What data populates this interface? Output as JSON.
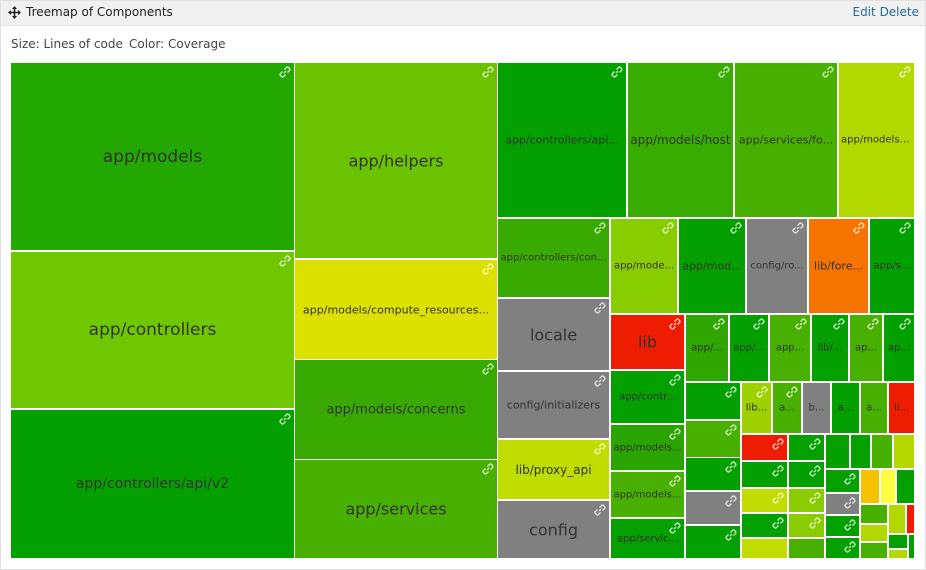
{
  "header": {
    "title": "Treemap of Components",
    "edit_label": "Edit",
    "delete_label": "Delete"
  },
  "subtitle": {
    "size": "Size: Lines of code",
    "color": "Color: Coverage"
  },
  "chart_data": {
    "type": "treemap",
    "size_metric": "Lines of code",
    "color_metric": "Coverage",
    "legend": "none",
    "tiles": [
      {
        "label": "app/models",
        "color": "#22a800"
      },
      {
        "label": "app/controllers",
        "color": "#6ec700"
      },
      {
        "label": "app/controllers/api/v2",
        "color": "#03a000"
      },
      {
        "label": "app/helpers",
        "color": "#6ac200"
      },
      {
        "label": "app/models/compute_resources...",
        "color": "#dde100"
      },
      {
        "label": "app/models/concerns",
        "color": "#38a900"
      },
      {
        "label": "app/services",
        "color": "#48b000"
      },
      {
        "label": "app/controllers/api...",
        "color": "#03a000"
      },
      {
        "label": "app/models/host",
        "color": "#38ac00"
      },
      {
        "label": "app/services/fo...",
        "color": "#48b000"
      },
      {
        "label": "app/models/...",
        "color": "#b3d800"
      },
      {
        "label": "app/controllers/con...",
        "color": "#39ab00"
      },
      {
        "label": "locale",
        "color": "#808080"
      },
      {
        "label": "config/initializers",
        "color": "#808080"
      },
      {
        "label": "lib/proxy_api",
        "color": "#c1dc00"
      },
      {
        "label": "config",
        "color": "#808080"
      },
      {
        "label": "app/mode...",
        "color": "#89cc00"
      },
      {
        "label": "app/mod...",
        "color": "#03a000"
      },
      {
        "label": "config/ro...",
        "color": "#808080"
      },
      {
        "label": "lib/fore...",
        "color": "#f57400"
      },
      {
        "label": "app/s...",
        "color": "#03a000"
      },
      {
        "label": "lib",
        "color": "#ee1c00"
      },
      {
        "label": "app/contr...",
        "color": "#03a000"
      },
      {
        "label": "app/models...",
        "color": "#2aa400"
      },
      {
        "label": "app/models...",
        "color": "#48b000"
      },
      {
        "label": "app/servic...",
        "color": "#03a000"
      },
      {
        "label": "app/...",
        "color": "#30a600"
      },
      {
        "label": "app/...",
        "color": "#03a000"
      },
      {
        "label": "app...",
        "color": "#48b000"
      },
      {
        "label": "lib/...",
        "color": "#03a000"
      },
      {
        "label": "ap...",
        "color": "#48b000"
      },
      {
        "label": "ap...",
        "color": "#03a000"
      },
      {
        "label": "",
        "color": "#03a000"
      },
      {
        "label": "lib...",
        "color": "#9ed100"
      },
      {
        "label": "a...",
        "color": "#48b000"
      },
      {
        "label": "b...",
        "color": "#808080"
      },
      {
        "label": "a...",
        "color": "#03a000"
      },
      {
        "label": "a...",
        "color": "#48b000"
      },
      {
        "label": "li...",
        "color": "#ee1c00"
      },
      {
        "label": "",
        "color": "#48b000"
      },
      {
        "label": "",
        "color": "#03a000"
      },
      {
        "label": "",
        "color": "#808080"
      },
      {
        "label": "",
        "color": "#03a000"
      },
      {
        "label": "",
        "color": "#ee1c00"
      },
      {
        "label": "",
        "color": "#03a000"
      },
      {
        "label": "",
        "color": "#03a000"
      },
      {
        "label": "",
        "color": "#03a000"
      },
      {
        "label": "",
        "color": "#c1dc00"
      },
      {
        "label": "",
        "color": "#89cc00"
      },
      {
        "label": "",
        "color": "#03a000"
      },
      {
        "label": "",
        "color": "#89cc00"
      },
      {
        "label": "",
        "color": "#c1dc00"
      },
      {
        "label": "",
        "color": "#48b000"
      },
      {
        "label": "",
        "color": "#03a000"
      },
      {
        "label": "",
        "color": "#03a000"
      },
      {
        "label": "",
        "color": "#48b000"
      },
      {
        "label": "",
        "color": "#b3d800"
      },
      {
        "label": "",
        "color": "#03a000"
      },
      {
        "label": "",
        "color": "#f5c200"
      },
      {
        "label": "",
        "color": "#ffff40"
      },
      {
        "label": "",
        "color": "#03a000"
      },
      {
        "label": "",
        "color": "#808080"
      },
      {
        "label": "",
        "color": "#03a000"
      },
      {
        "label": "",
        "color": "#03a000"
      },
      {
        "label": "",
        "color": "#48b000"
      },
      {
        "label": "",
        "color": "#b3d800"
      },
      {
        "label": "",
        "color": "#b3d800"
      },
      {
        "label": "",
        "color": "#ee1c00"
      },
      {
        "label": "",
        "color": "#48b000"
      },
      {
        "label": "",
        "color": "#03a000"
      },
      {
        "label": "",
        "color": "#03a000"
      },
      {
        "label": "",
        "color": "#b3d800"
      },
      {
        "label": "",
        "color": "#808080"
      },
      {
        "label": "",
        "color": "#b3d800"
      }
    ]
  }
}
